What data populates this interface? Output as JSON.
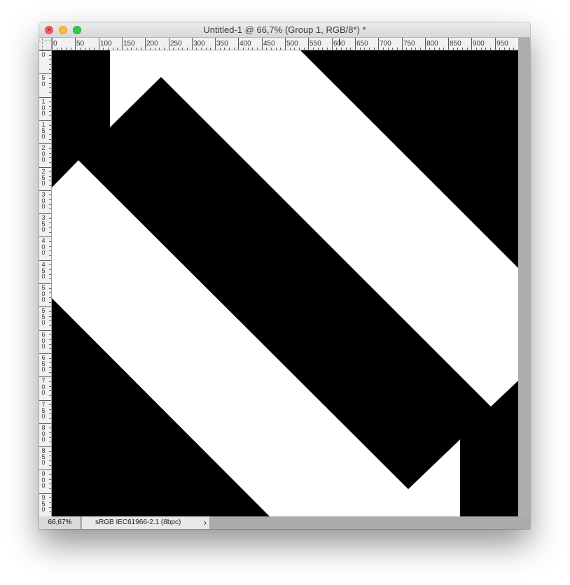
{
  "window": {
    "title": "Untitled-1 @ 66,7% (Group 1, RGB/8*) *",
    "close_glyph": "×"
  },
  "icons": {
    "close": "close-icon",
    "minimize": "minimize-icon",
    "zoom": "zoom-window-icon",
    "status_menu": "chevron-right-icon"
  },
  "ruler_h": {
    "labels": [
      "0",
      "50",
      "100",
      "150",
      "200",
      "250",
      "300",
      "350",
      "400",
      "450",
      "500",
      "550",
      "600",
      "650",
      "700",
      "750",
      "800",
      "850",
      "900",
      "950"
    ]
  },
  "ruler_v": {
    "labels": [
      "0",
      "50",
      "100",
      "150",
      "200",
      "250",
      "300",
      "350",
      "400",
      "450",
      "500",
      "550",
      "600",
      "650",
      "700",
      "750",
      "800",
      "850",
      "900",
      "950"
    ]
  },
  "canvas": {
    "background": "#000000",
    "shape_color": "#ffffff"
  },
  "status": {
    "zoom": "66,67%",
    "profile": "sRGB IEC61966-2.1 (8bpc)",
    "menu_arrow": "›"
  },
  "colors": {
    "close": "#fc605b",
    "minimize": "#fdbc40",
    "zoom": "#34c84a"
  }
}
